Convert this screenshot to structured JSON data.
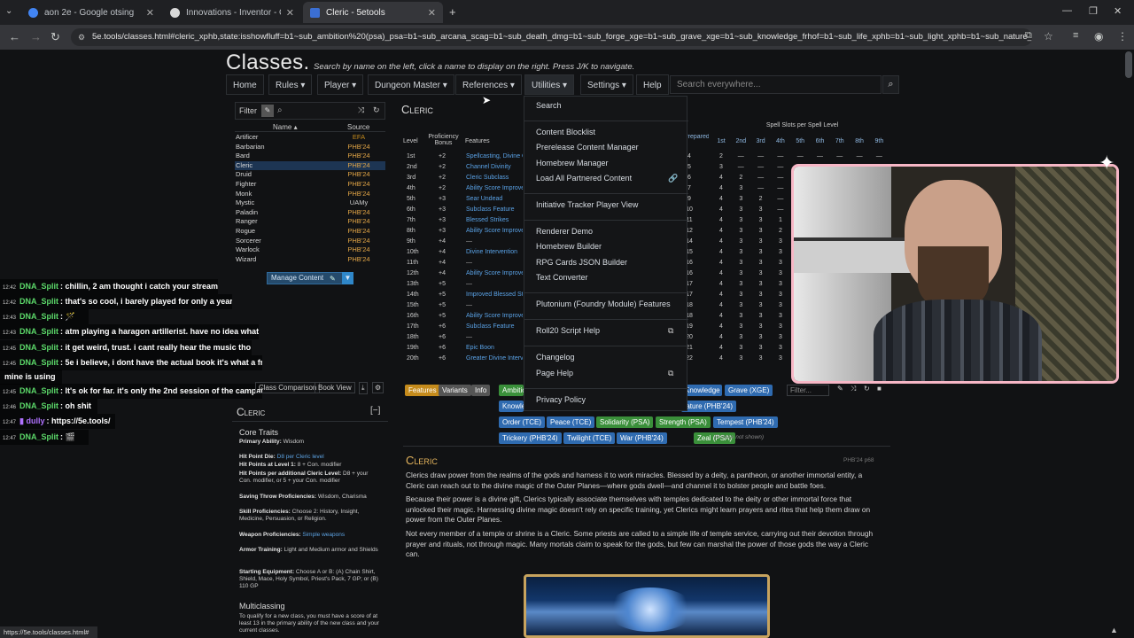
{
  "browser": {
    "tabs": [
      {
        "title": "aon 2e - Google otsing",
        "fav": "#4285f4"
      },
      {
        "title": "Innovations - Inventor - Classe",
        "fav": "#d8d8d8"
      },
      {
        "title": "Cleric - 5etools",
        "fav": "#3b6fd4"
      }
    ],
    "url": "5e.tools/classes.html#cleric_xphb,state:isshowfluff=b1~sub_ambition%20(psa)_psa=b1~sub_arcana_scag=b1~sub_death_dmg=b1~sub_forge_xge=b1~sub_grave_xge=b1~sub_knowledge_frhof=b1~sub_life_xphb=b1~sub_light_xphb=b1~sub_nature_p...",
    "status_url": "https://5e.tools/classes.html#"
  },
  "page": {
    "title": "Classes.",
    "subtitle": "Search by name on the left, click a name to display on the right. Press J/K to navigate.",
    "nav": [
      "Home",
      "Rules ▾",
      "Player ▾",
      "Dungeon Master ▾",
      "References ▾",
      "Utilities ▾",
      "Settings ▾",
      "Help"
    ],
    "search_placeholder": "Search everywhere..."
  },
  "classlist": {
    "filter_label": "Filter",
    "col_name": "Name ▴",
    "col_source": "Source",
    "rows": [
      [
        "Artificer",
        "EFA"
      ],
      [
        "Barbarian",
        "PHB'24"
      ],
      [
        "Bard",
        "PHB'24"
      ],
      [
        "Cleric",
        "PHB'24"
      ],
      [
        "Druid",
        "PHB'24"
      ],
      [
        "Fighter",
        "PHB'24"
      ],
      [
        "Monk",
        "PHB'24"
      ],
      [
        "Mystic",
        "UAMy"
      ],
      [
        "Paladin",
        "PHB'24"
      ],
      [
        "Ranger",
        "PHB'24"
      ],
      [
        "Rogue",
        "PHB'24"
      ],
      [
        "Sorcerer",
        "PHB'24"
      ],
      [
        "Warlock",
        "PHB'24"
      ],
      [
        "Wizard",
        "PHB'24"
      ]
    ],
    "manage": "Manage Content"
  },
  "chat": [
    {
      "time": "12:42",
      "user": "DNA_Split",
      "msg": ": chillin, 2 am thought i catch your stream"
    },
    {
      "time": "12:42",
      "user": "DNA_Split",
      "msg": ": that's so cool, i barely played for only a year"
    },
    {
      "time": "12:43",
      "user": "DNA_Split",
      "msg": ": 🪄"
    },
    {
      "time": "12:43",
      "user": "DNA_Split",
      "msg": ": atm playing a haragon artillerist. have no idea what i"
    },
    {
      "time": "12:45",
      "user": "DNA_Split",
      "msg": ": it get weird, trust. i cant really hear the music tho"
    },
    {
      "time": "12:45",
      "user": "DNA_Split",
      "msg": ": 5e i believe, i dont have the actual book it's what a fr"
    },
    {
      "time": "",
      "user": "",
      "msg": "mine is using"
    },
    {
      "time": "12:45",
      "user": "DNA_Split",
      "msg": ": It's ok for far. it's only the 2nd session of the campai"
    },
    {
      "time": "12:46",
      "user": "DNA_Split",
      "msg": ": oh shit"
    },
    {
      "time": "12:47",
      "user": "dully",
      "msg": ": https://5e.tools/"
    },
    {
      "time": "12:47",
      "user": "DNA_Split",
      "msg": ": 🎬"
    }
  ],
  "leftpanel": {
    "tabs": [
      "Class Comparison",
      "Book View"
    ],
    "heading": "Cleric",
    "core": "Core Traits",
    "primary_label": "Primary Ability:",
    "primary": "Wisdom",
    "hpdie_label": "Hit Point Die:",
    "hpdie": "D8 per Cleric level",
    "hp1_label": "Hit Points at Level 1:",
    "hp1": "8 + Con. modifier",
    "hpadd_label": "Hit Points per additional Cleric Level:",
    "hpadd": "D8 + your Con. modifier, or 5 + your Con. modifier",
    "saves_label": "Saving Throw Proficiencies:",
    "saves": "Wisdom, Charisma",
    "skills_label": "Skill Proficiencies:",
    "skills": "Choose 2: History, Insight, Medicine, Persuasion, or Religion.",
    "weapons_label": "Weapon Proficiencies:",
    "weapons": "Simple weapons",
    "armor_label": "Armor Training:",
    "armor": "Light and Medium armor and Shields",
    "equip_label": "Starting Equipment:",
    "equip": "Choose A or B: (A) Chain Shirt, Shield, Mace, Holy Symbol, Priest's Pack, 7 GP; or (B) 110 GP",
    "multi": "Multiclassing",
    "multi_text": "To qualify for a new class, you must have a score of at least 13 in the primary ability of the new class and your current classes."
  },
  "table": {
    "title": "Cleric",
    "h_level": "Level",
    "h_prof": "Proficiency Bonus",
    "h_feat": "Features",
    "h_prep": "Prepared Spells",
    "h_slots": "Spell Slots per Spell Level",
    "slot_levels": [
      "1st",
      "2nd",
      "3rd",
      "4th",
      "5th",
      "6th",
      "7th",
      "8th",
      "9th"
    ],
    "rows": [
      [
        "1st",
        "+2",
        "Spellcasting, Divine Order"
      ],
      [
        "2nd",
        "+2",
        "Channel Divinity"
      ],
      [
        "3rd",
        "+2",
        "Cleric Subclass"
      ],
      [
        "4th",
        "+2",
        "Ability Score Improvement"
      ],
      [
        "5th",
        "+3",
        "Sear Undead"
      ],
      [
        "6th",
        "+3",
        "Subclass Feature"
      ],
      [
        "7th",
        "+3",
        "Blessed Strikes"
      ],
      [
        "8th",
        "+3",
        "Ability Score Improvement"
      ],
      [
        "9th",
        "+4",
        "—"
      ],
      [
        "10th",
        "+4",
        "Divine Intervention"
      ],
      [
        "11th",
        "+4",
        "—"
      ],
      [
        "12th",
        "+4",
        "Ability Score Improvement"
      ],
      [
        "13th",
        "+5",
        "—"
      ],
      [
        "14th",
        "+5",
        "Improved Blessed Strikes"
      ],
      [
        "15th",
        "+5",
        "—"
      ],
      [
        "16th",
        "+5",
        "Ability Score Improvement"
      ],
      [
        "17th",
        "+6",
        "Subclass Feature"
      ],
      [
        "18th",
        "+6",
        "—"
      ],
      [
        "19th",
        "+6",
        "Epic Boon"
      ],
      [
        "20th",
        "+6",
        "Greater Divine Intervention"
      ]
    ],
    "slots": [
      [
        "4",
        "2",
        "—",
        "—",
        "—",
        "—",
        "—",
        "—",
        "—",
        "—"
      ],
      [
        "5",
        "3",
        "—",
        "—",
        "—",
        "—",
        "—",
        "—",
        "—",
        "—"
      ],
      [
        "6",
        "4",
        "2",
        "—",
        "—",
        "—",
        "—",
        "—",
        "—",
        "—"
      ],
      [
        "7",
        "4",
        "3",
        "—",
        "—",
        "—",
        "—",
        "—",
        "—",
        "—"
      ],
      [
        "9",
        "4",
        "3",
        "2",
        "—",
        "—",
        "—",
        "—",
        "—",
        "—"
      ],
      [
        "10",
        "4",
        "3",
        "3",
        "—",
        "—",
        "—",
        "—",
        "—",
        "—"
      ],
      [
        "11",
        "4",
        "3",
        "3",
        "1",
        "—",
        "—",
        "—",
        "—",
        "—"
      ],
      [
        "12",
        "4",
        "3",
        "3",
        "2",
        "—",
        "—",
        "—",
        "—",
        "—"
      ],
      [
        "14",
        "4",
        "3",
        "3",
        "3",
        "1",
        "—",
        "—",
        "—",
        "—"
      ],
      [
        "15",
        "4",
        "3",
        "3",
        "3",
        "2",
        "—",
        "—",
        "—",
        "—"
      ],
      [
        "16",
        "4",
        "3",
        "3",
        "3",
        "2",
        "1",
        "—",
        "—",
        "—"
      ],
      [
        "16",
        "4",
        "3",
        "3",
        "3",
        "2",
        "1",
        "—",
        "—",
        "—"
      ],
      [
        "17",
        "4",
        "3",
        "3",
        "3",
        "2",
        "1",
        "1",
        "—",
        "—"
      ],
      [
        "17",
        "4",
        "3",
        "3",
        "3",
        "2",
        "1",
        "1",
        "—",
        "—"
      ],
      [
        "18",
        "4",
        "3",
        "3",
        "3",
        "2",
        "1",
        "1",
        "1",
        "—"
      ],
      [
        "18",
        "4",
        "3",
        "3",
        "3",
        "2",
        "1",
        "1",
        "1",
        "—"
      ],
      [
        "19",
        "4",
        "3",
        "3",
        "3",
        "2",
        "1",
        "1",
        "1",
        "1"
      ],
      [
        "20",
        "4",
        "3",
        "3",
        "3",
        "3",
        "1",
        "1",
        "1",
        "1"
      ],
      [
        "21",
        "4",
        "3",
        "3",
        "3",
        "3",
        "2",
        "1",
        "1",
        "1"
      ],
      [
        "22",
        "4",
        "3",
        "3",
        "3",
        "3",
        "2",
        "2",
        "1",
        "1"
      ]
    ]
  },
  "utilities": {
    "items": [
      "Search",
      "Content Blocklist",
      "Prerelease Content Manager",
      "Homebrew Manager",
      "Load All Partnered Content",
      "Initiative Tracker Player View",
      "Renderer Demo",
      "Homebrew Builder",
      "RPG Cards JSON Builder",
      "Text Converter",
      "Plutonium (Foundry Module) Features",
      "Roll20 Script Help",
      "Changelog",
      "Page Help",
      "Privacy Policy"
    ]
  },
  "subclasses": {
    "toggles": [
      "Features",
      "Variants",
      "Info"
    ],
    "row1": [
      "Ambition (PSA)",
      "Grave (XGE)",
      "Knowledge (XGE)"
    ],
    "row2": [
      "Knowledge (FRHoF)",
      "Nature (PHB'24)"
    ],
    "row3": [
      "Order (TCE)",
      "Peace (TCE)",
      "Solidarity (PSA)",
      "Strength (PSA)",
      "Tempest (PHB'24)"
    ],
    "row4": [
      "Trickery (PHB'24)",
      "Twilight (TCE)",
      "War (PHB'24)",
      "Zeal (PSA)"
    ],
    "more": "(6 more not shown)",
    "filter": "Filter..."
  },
  "body": {
    "heading": "Cleric",
    "source": "PHB'24 p68",
    "p1": "Clerics draw power from the realms of the gods and harness it to work miracles. Blessed by a deity, a pantheon, or another immortal entity, a Cleric can reach out to the divine magic of the Outer Planes—where gods dwell—and channel it to bolster people and battle foes.",
    "p2": "Because their power is a divine gift, Clerics typically associate themselves with temples dedicated to the deity or other immortal force that unlocked their magic. Harnessing divine magic doesn't rely on specific training, yet Clerics might learn prayers and rites that help them draw on power from the Outer Planes.",
    "p3": "Not every member of a temple or shrine is a Cleric. Some priests are called to a simple life of temple service, carrying out their devotion through prayer and rituals, not through magic. Many mortals claim to speak for the gods, but few can marshal the power of those gods the way a Cleric can."
  }
}
